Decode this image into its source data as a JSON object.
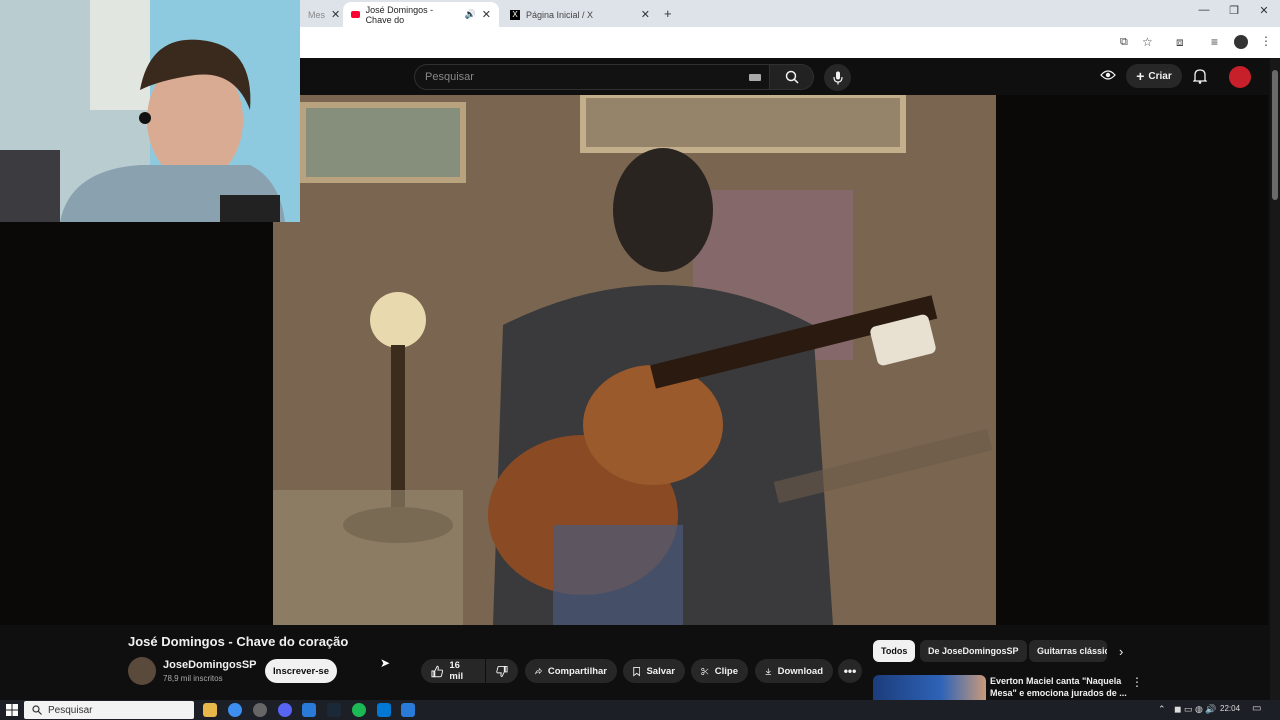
{
  "browser": {
    "tabs": [
      {
        "label": "Mes",
        "active": false
      },
      {
        "label": "José Domingos - Chave do",
        "active": true
      },
      {
        "label": "Página Inicial / X",
        "active": false
      }
    ],
    "new_tab_label": "+"
  },
  "youtube": {
    "search_placeholder": "Pesquisar",
    "create_label": "Criar",
    "video_title": "José Domingos - Chave do coração",
    "channel_name": "JoseDomingosSP",
    "subscribers": "78,9 mil inscritos",
    "subscribe_label": "Inscrever-se",
    "likes": "16 mil",
    "share_label": "Compartilhar",
    "save_label": "Salvar",
    "clip_label": "Clipe",
    "download_label": "Download",
    "chips": [
      "Todos",
      "De JoseDomingosSP",
      "Guitarras clássic"
    ],
    "recommendation_title": "Everton Maciel canta \"Naquela Mesa\" e emociona jurados de ..."
  },
  "taskbar": {
    "search_label": "Pesquisar",
    "time": "22:04"
  },
  "colors": {
    "accent_red": "#ff0033",
    "background": "#0f0f0f"
  }
}
